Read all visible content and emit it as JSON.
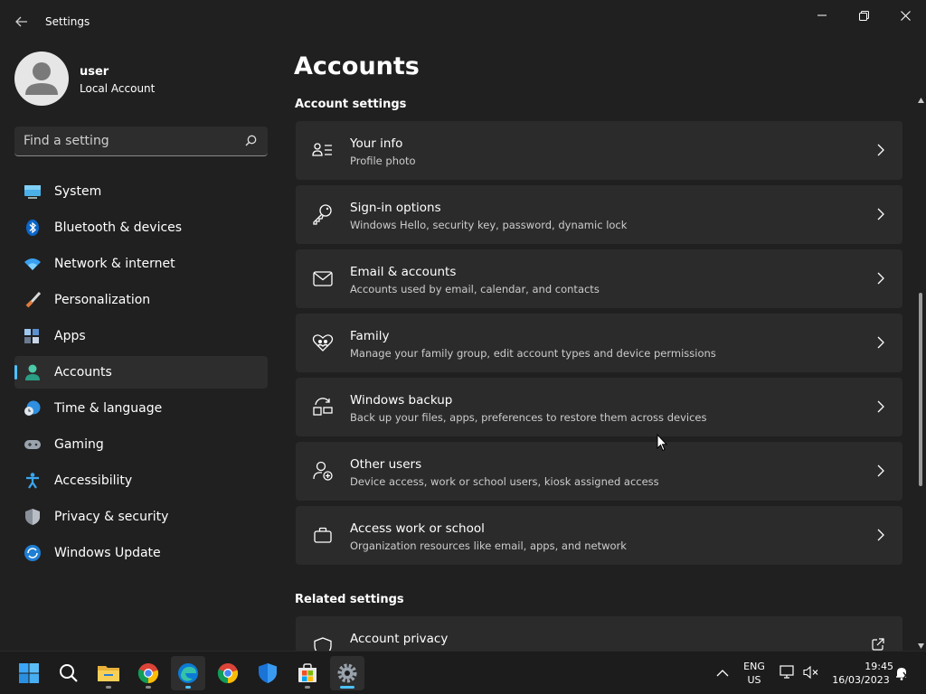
{
  "window": {
    "title": "Settings"
  },
  "profile": {
    "name": "user",
    "account_type": "Local Account"
  },
  "search": {
    "placeholder": "Find a setting"
  },
  "sidebar": {
    "items": [
      {
        "label": "System",
        "icon": "monitor-icon"
      },
      {
        "label": "Bluetooth & devices",
        "icon": "bluetooth-icon"
      },
      {
        "label": "Network & internet",
        "icon": "wifi-icon"
      },
      {
        "label": "Personalization",
        "icon": "paintbrush-icon"
      },
      {
        "label": "Apps",
        "icon": "apps-icon"
      },
      {
        "label": "Accounts",
        "icon": "person-icon",
        "active": true
      },
      {
        "label": "Time & language",
        "icon": "globe-clock-icon"
      },
      {
        "label": "Gaming",
        "icon": "gamepad-icon"
      },
      {
        "label": "Accessibility",
        "icon": "accessibility-icon"
      },
      {
        "label": "Privacy & security",
        "icon": "shield-icon"
      },
      {
        "label": "Windows Update",
        "icon": "refresh-icon"
      }
    ]
  },
  "main": {
    "title": "Accounts",
    "account_settings_heading": "Account settings",
    "cards": [
      {
        "title": "Your info",
        "subtitle": "Profile photo",
        "icon": "person-list-icon"
      },
      {
        "title": "Sign-in options",
        "subtitle": "Windows Hello, security key, password, dynamic lock",
        "icon": "key-icon"
      },
      {
        "title": "Email & accounts",
        "subtitle": "Accounts used by email, calendar, and contacts",
        "icon": "mail-icon"
      },
      {
        "title": "Family",
        "subtitle": "Manage your family group, edit account types and device permissions",
        "icon": "family-heart-icon"
      },
      {
        "title": "Windows backup",
        "subtitle": "Back up your files, apps, preferences to restore them across devices",
        "icon": "backup-icon"
      },
      {
        "title": "Other users",
        "subtitle": "Device access, work or school users, kiosk assigned access",
        "icon": "person-add-icon"
      },
      {
        "title": "Access work or school",
        "subtitle": "Organization resources like email, apps, and network",
        "icon": "briefcase-icon"
      }
    ],
    "related_heading": "Related settings",
    "related": [
      {
        "title": "Account privacy",
        "icon": "shield-outline-icon",
        "action_icon": "open-external-icon"
      }
    ]
  },
  "taskbar": {
    "apps": [
      "start-icon",
      "search-icon",
      "file-explorer-icon",
      "chrome-icon",
      "edge-icon",
      "chrome-icon",
      "defender-icon",
      "store-icon",
      "settings-icon"
    ],
    "language": {
      "line1": "ENG",
      "line2": "US"
    },
    "clock": {
      "time": "19:45",
      "date": "16/03/2023"
    }
  },
  "colors": {
    "accent": "#4cc2ff",
    "background": "#202020",
    "card": "#2b2b2b"
  }
}
